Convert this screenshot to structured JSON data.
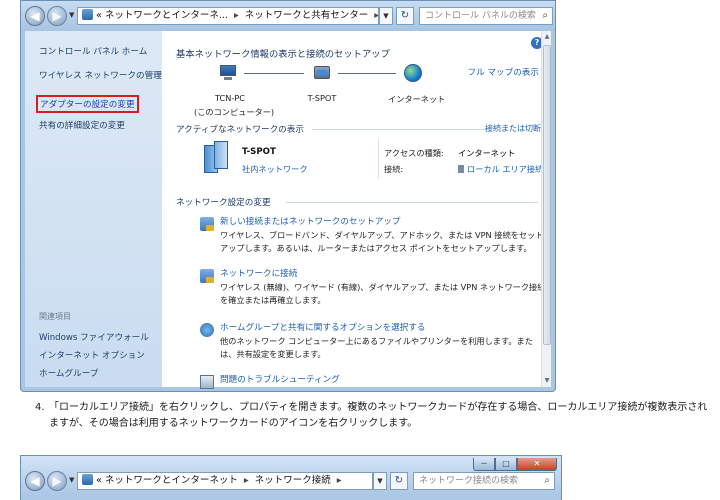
{
  "window1": {
    "address": {
      "prefix": "«",
      "crumbs": [
        "ネットワークとインターネ...",
        "ネットワークと共有センター"
      ],
      "separator": "▸"
    },
    "search": {
      "placeholder": "コントロール パネルの検索"
    },
    "sidebar": {
      "items": [
        {
          "label": "コントロール パネル ホーム"
        },
        {
          "label": "ワイヤレス ネットワークの管理"
        },
        {
          "label": "アダプターの設定の変更",
          "highlighted": true
        },
        {
          "label": "共有の詳細設定の変更"
        }
      ],
      "related_heading": "関連項目",
      "related": [
        {
          "label": "Windows ファイアウォール"
        },
        {
          "label": "インターネット オプション"
        },
        {
          "label": "ホームグループ"
        }
      ]
    },
    "content": {
      "heading": "基本ネットワーク情報の表示と接続のセットアップ",
      "full_map_link": "フル マップの表示",
      "map": [
        {
          "label": "TCN-PC",
          "sub": "(このコンピューター)",
          "icon": "computer-icon"
        },
        {
          "label": "T-SPOT",
          "icon": "network-icon"
        },
        {
          "label": "インターネット",
          "icon": "globe-icon"
        }
      ],
      "active_heading": "アクティブなネットワークの表示",
      "disconnect_link": "接続または切断",
      "active_network": {
        "name": "T-SPOT",
        "type": "社内ネットワーク",
        "access_key": "アクセスの種類:",
        "access_value": "インターネット",
        "conn_key": "接続:",
        "conn_value": "ローカル エリア接続"
      },
      "settings_heading": "ネットワーク設定の変更",
      "tasks": [
        {
          "link": "新しい接続またはネットワークのセットアップ",
          "desc": "ワイヤレス、ブロードバンド、ダイヤルアップ、アドホック、または VPN 接続をセットアップします。あるいは、ルーターまたはアクセス ポイントをセットアップします。",
          "icon": "network-setup-icon"
        },
        {
          "link": "ネットワークに接続",
          "desc": "ワイヤレス (無線)、ワイヤード (有線)、ダイヤルアップ、または VPN ネットワーク接続を確立または再確立します。",
          "icon": "network-connect-icon"
        },
        {
          "link": "ホームグループと共有に関するオプションを選択する",
          "desc": "他のネットワーク コンピューター上にあるファイルやプリンターを利用します。または、共有設定を変更します。",
          "icon": "homegroup-icon"
        },
        {
          "link": "問題のトラブルシューティング",
          "icon": "troubleshoot-icon"
        }
      ]
    }
  },
  "instruction": {
    "number": "4.",
    "text": "「ローカルエリア接続」を右クリックし、プロパティを開きます。複数のネットワークカードが存在する場合、ローカルエリア接続が複数表示されますが、その場合は利用するネットワークカードのアイコンを右クリックします。"
  },
  "window2": {
    "address": {
      "prefix": "«",
      "crumbs": [
        "ネットワークとインターネット",
        "ネットワーク接続"
      ],
      "separator": "▸"
    },
    "search": {
      "placeholder": "ネットワーク接続の検索"
    },
    "controls": {
      "min": "─",
      "max": "□",
      "close": "✕"
    }
  },
  "colors": {
    "link": "#1a5fb4",
    "highlight_border": "#d42020",
    "chrome": "#a9c7e4"
  }
}
